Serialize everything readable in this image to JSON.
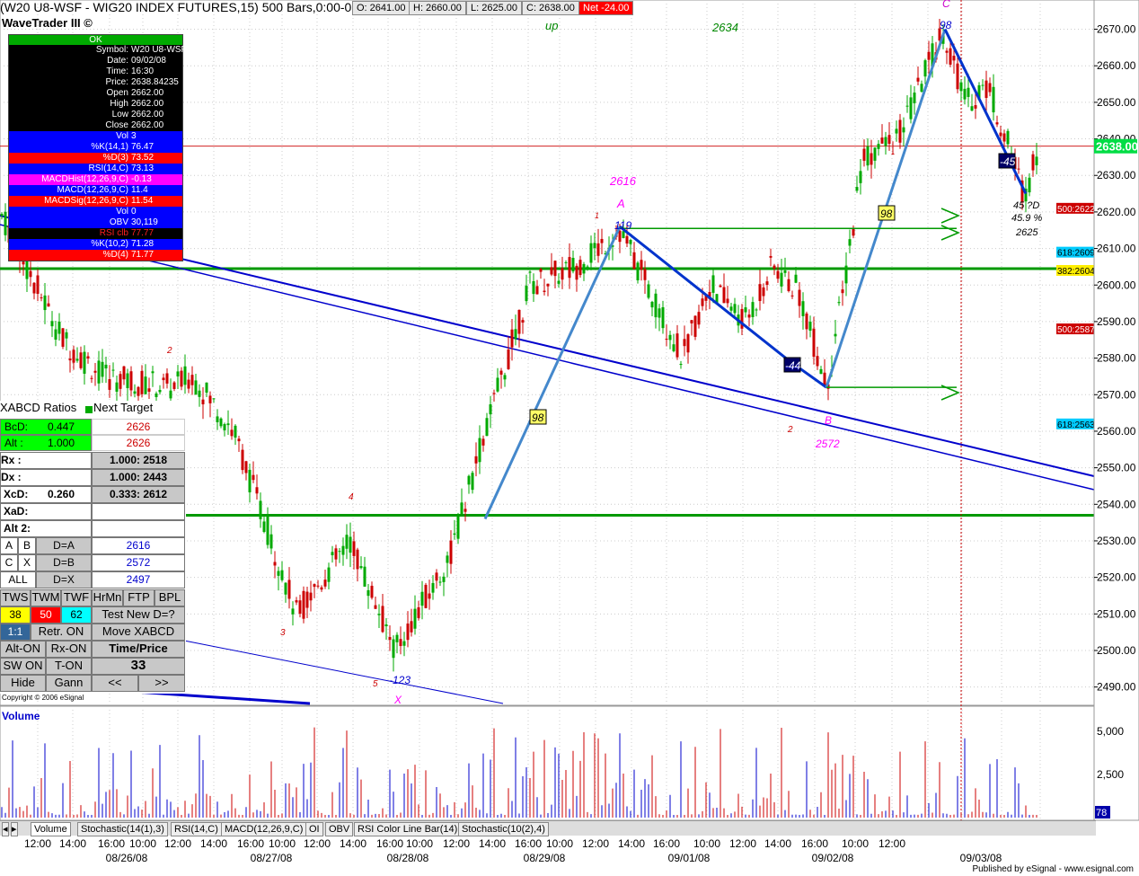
{
  "header": {
    "title": "(W20 U8-WSF - WIG20 INDEX FUTURES,15) 500 Bars,0:00-0:00",
    "open": "O: 2641.00",
    "high": "H: 2660.00",
    "low": "L: 2625.00",
    "close": "C: 2638.00",
    "net": "Net -24.00",
    "brand": "WaveTrader III ©"
  },
  "data_window": {
    "status": "OK",
    "rows": [
      {
        "label": "Symbol:",
        "value": "W20 U8-WSF,15",
        "bg": "#000000",
        "fg": "#ffffff"
      },
      {
        "label": "Date:",
        "value": "09/02/08",
        "bg": "#000000",
        "fg": "#ffffff"
      },
      {
        "label": "Time:",
        "value": "16:30",
        "bg": "#000000",
        "fg": "#ffffff"
      },
      {
        "label": "Price:",
        "value": "2638.84235",
        "bg": "#000000",
        "fg": "#ffffff"
      },
      {
        "label": "Open",
        "value": "2662.00",
        "bg": "#000000",
        "fg": "#ffffff"
      },
      {
        "label": "High",
        "value": "2662.00",
        "bg": "#000000",
        "fg": "#ffffff"
      },
      {
        "label": "Low",
        "value": "2662.00",
        "bg": "#000000",
        "fg": "#ffffff"
      },
      {
        "label": "Close",
        "value": "2662.00",
        "bg": "#000000",
        "fg": "#ffffff"
      },
      {
        "label": "Vol",
        "value": "3",
        "bg": "#0000ff",
        "fg": "#ffffff"
      },
      {
        "label": "%K(14,1)",
        "value": "76.47",
        "bg": "#0000ff",
        "fg": "#ffffff"
      },
      {
        "label": "%D(3)",
        "value": "73.52",
        "bg": "#ff0000",
        "fg": "#ffffff"
      },
      {
        "label": "RSI(14,C)",
        "value": "73.13",
        "bg": "#0000ff",
        "fg": "#ffffff"
      },
      {
        "label": "MACDHist(12,26,9,C)",
        "value": "-0.13",
        "bg": "#ff00ff",
        "fg": "#ffffff"
      },
      {
        "label": "MACD(12,26,9,C)",
        "value": "11.4",
        "bg": "#0000ff",
        "fg": "#ffffff"
      },
      {
        "label": "MACDSig(12,26,9,C)",
        "value": "11.54",
        "bg": "#ff0000",
        "fg": "#ffffff"
      },
      {
        "label": "Vol",
        "value": "0",
        "bg": "#0000ff",
        "fg": "#ffffff"
      },
      {
        "label": "OBV",
        "value": "30,119",
        "bg": "#0000ff",
        "fg": "#ffffff"
      },
      {
        "label": "RSI clb",
        "value": "77.77",
        "bg": "#000000",
        "fg": "#ff2020"
      },
      {
        "label": "%K(10,2)",
        "value": "71.28",
        "bg": "#0000ff",
        "fg": "#ffffff"
      },
      {
        "label": "%D(4)",
        "value": "71.77",
        "bg": "#ff0000",
        "fg": "#ffffff"
      }
    ]
  },
  "xabcd": {
    "title": "XABCD Ratios",
    "next_target": "Next Target",
    "bcd_label": "BcD:",
    "bcd_value": "0.447",
    "alt_label": "Alt :",
    "alt_value": "1.000",
    "target1": "2626",
    "target2": "2626",
    "rx_label": "Rx :",
    "rx_value": "1.000: 2518",
    "dx_label": "Dx :",
    "dx_value": "1.000: 2443",
    "xcd_label": "XcD:",
    "xcd_left": "0.260",
    "xcd_value": "0.333: 2612",
    "xad_label": "XaD:",
    "alt2_label": "Alt 2:",
    "a_label": "A",
    "b_label": "B",
    "da_label": "D=A",
    "da_value": "2616",
    "c_label": "C",
    "x_label": "X",
    "db_label": "D=B",
    "db_value": "2572",
    "all_label": "ALL",
    "dx2_label": "D=X",
    "dx2_value": "2497",
    "tws": "TWS",
    "twm": "TWM",
    "twf": "TWF",
    "hrmn": "HrMn",
    "ftp": "FTP",
    "bpl": "BPL",
    "v38": "38",
    "v50": "50",
    "v62": "62",
    "test_new": "Test New D=?",
    "ratio": "1:1",
    "retr_on": "Retr. ON",
    "move_xabcd": "Move XABCD",
    "alt_on": "Alt-ON",
    "rx_on": "Rx-ON",
    "time_price": "Time/Price",
    "sw_on": "SW ON",
    "t_on": "T-ON",
    "timeprice_value": "33",
    "hide": "Hide",
    "gann": "Gann",
    "prev": "<<",
    "next": ">>"
  },
  "copyright": "Copyright © 2006 eSignal",
  "tabs": [
    "Volume",
    "Stochastic(14(1),3)",
    "RSI(14,C)",
    "MACD(12,26,9,C)",
    "OI",
    "OBV",
    "RSI Color Line Bar(14)",
    "Stochastic(10(2),4)"
  ],
  "published": "Published by eSignal - www.esignal.com",
  "chart_data": {
    "type": "candlestick",
    "price_axis": {
      "min": 2485,
      "max": 2680,
      "ticks": [
        "2670.00",
        "2660.00",
        "2650.00",
        "2640.00",
        "2630.00",
        "2620.00",
        "2610.00",
        "2600.00",
        "2590.00",
        "2580.00",
        "2570.00",
        "2560.00",
        "2550.00",
        "2540.00",
        "2530.00",
        "2520.00",
        "2510.00",
        "2500.00",
        "2490.00"
      ]
    },
    "last_price": "2638.00",
    "volume_axis": {
      "ticks": [
        "5,000",
        "2,500"
      ],
      "last": "78",
      "title": "Volume"
    },
    "time_ticks": [
      "12:00",
      "14:00",
      "16:00",
      "10:00",
      "12:00",
      "14:00",
      "16:00",
      "10:00",
      "12:00",
      "14:00",
      "16:00",
      "10:00",
      "12:00",
      "14:00",
      "16:00",
      "10:00",
      "12:00",
      "14:00",
      "16:00",
      "10:00",
      "12:00",
      "14:00",
      "16:00",
      "10:00",
      "12:00"
    ],
    "date_ticks": [
      "08/26/08",
      "08/27/08",
      "08/28/08",
      "08/29/08",
      "09/01/08",
      "09/02/08",
      "09/03/08"
    ],
    "fib_labels": [
      {
        "text": "500:2622",
        "bg": "#cc0000",
        "price": 2621
      },
      {
        "text": "618:2609",
        "bg": "#00ccff",
        "price": 2609
      },
      {
        "text": "382:2604",
        "bg": "#ffee00",
        "price": 2604
      },
      {
        "text": "500:2587",
        "bg": "#cc0000",
        "price": 2588
      },
      {
        "text": "618:2563",
        "bg": "#00ccff",
        "price": 2562
      }
    ],
    "horizontal_levels": [
      2604,
      2537,
      2639
    ],
    "wave_labels": [
      {
        "text": "up",
        "color": "#008800"
      },
      {
        "text": "2634",
        "color": "#008800"
      },
      {
        "text": "98",
        "color": "#0000cc"
      },
      {
        "text": "C",
        "color": "#cc00cc"
      },
      {
        "text": "2616",
        "color": "#ff00ff"
      },
      {
        "text": "A",
        "color": "#ff00ff"
      },
      {
        "text": "119",
        "color": "#0000cc"
      },
      {
        "text": "-44",
        "color": "#0000cc"
      },
      {
        "text": "B",
        "color": "#ff00ff"
      },
      {
        "text": "2572",
        "color": "#ff00ff"
      },
      {
        "text": "-123",
        "color": "#0000cc"
      },
      {
        "text": "X",
        "color": "#ff00ff"
      },
      {
        "text": "45 ?D",
        "color": "#000000"
      },
      {
        "text": "45.9 %",
        "color": "#000000"
      },
      {
        "text": "2625",
        "color": "#000000"
      },
      {
        "text": "1",
        "color": "#cc0000"
      },
      {
        "text": "2",
        "color": "#cc0000"
      },
      {
        "text": "3",
        "color": "#cc0000"
      },
      {
        "text": "4",
        "color": "#cc0000"
      },
      {
        "text": "5",
        "color": "#cc0000"
      },
      {
        "text": "2",
        "color": "#cc0000"
      }
    ],
    "pivots": [
      {
        "name": "X",
        "price": 2498
      },
      {
        "name": "A",
        "price": 2616
      },
      {
        "name": "B",
        "price": 2572
      },
      {
        "name": "C",
        "price": 2670
      },
      {
        "name": "D",
        "price": 2625
      }
    ]
  }
}
